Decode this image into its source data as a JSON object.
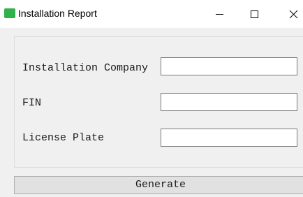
{
  "window": {
    "title": "Installation Report",
    "icon": "app-logo-icon",
    "icon_color": "#2fb24a"
  },
  "form": {
    "fields": [
      {
        "label": "Installation Company",
        "value": "",
        "placeholder": ""
      },
      {
        "label": "FIN",
        "value": "",
        "placeholder": ""
      },
      {
        "label": "License Plate",
        "value": "",
        "placeholder": ""
      }
    ]
  },
  "actions": {
    "generate_label": "Generate"
  }
}
